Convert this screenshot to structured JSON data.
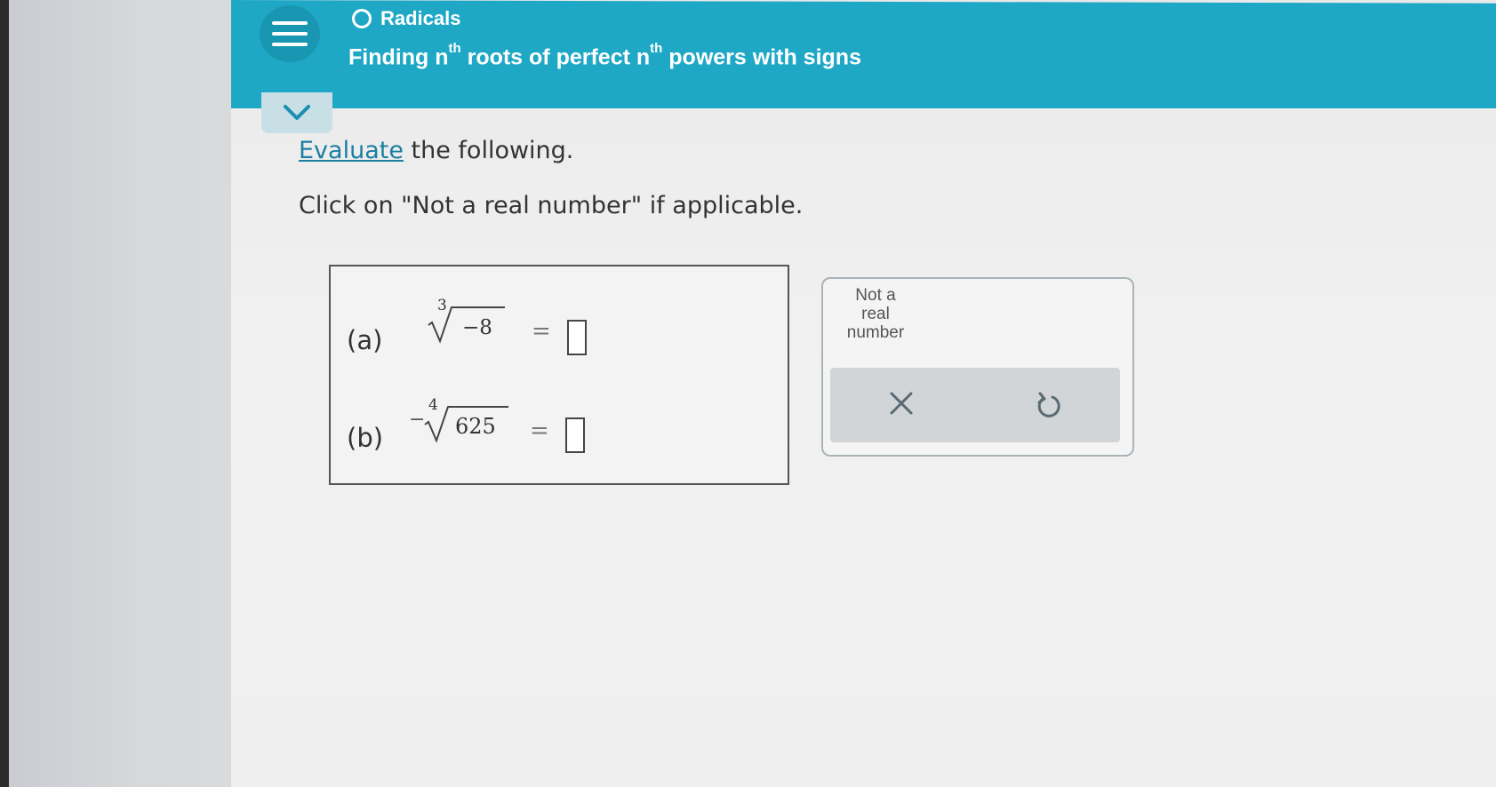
{
  "header": {
    "topic": "Radicals",
    "title_parts": {
      "t1": "Finding n",
      "sup1": "th",
      "t2": " roots of perfect n",
      "sup2": "th",
      "t3": " powers with signs"
    }
  },
  "instructions": {
    "link_word": "Evaluate",
    "rest": " the following.",
    "line2": "Click on \"Not a real number\" if applicable."
  },
  "problems": [
    {
      "label": "(a)",
      "sign": "",
      "index": "3",
      "radicand": "−8",
      "equals": "="
    },
    {
      "label": "(b)",
      "sign": "−",
      "index": "4",
      "radicand": "625",
      "equals": "="
    }
  ],
  "tools": {
    "not_real_line1": "Not a",
    "not_real_line2": "real",
    "not_real_line3": "number",
    "clear_icon": "x-icon",
    "undo_icon": "undo-icon"
  },
  "colors": {
    "header": "#1fa8c6",
    "accent_link": "#1a7fa1"
  }
}
